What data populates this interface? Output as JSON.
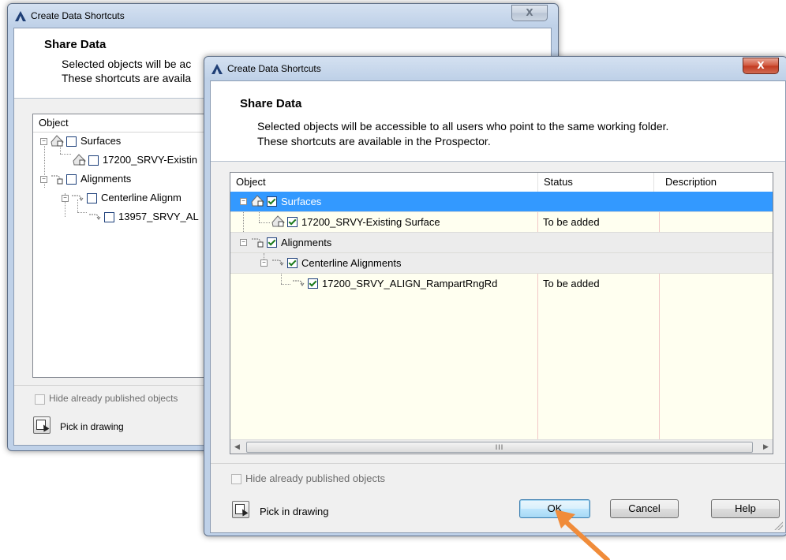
{
  "background_dialog": {
    "title": "Create Data Shortcuts",
    "close_label": "X",
    "heading": "Share Data",
    "desc_line1": "Selected objects will be ac",
    "desc_line2": "These shortcuts are availa",
    "column_object": "Object",
    "tree": [
      {
        "label": "Surfaces",
        "checked": false
      },
      {
        "label": "17200_SRVY-Existin",
        "checked": false
      },
      {
        "label": "Alignments",
        "checked": false
      },
      {
        "label": "Centerline Alignm",
        "checked": false
      },
      {
        "label": "13957_SRVY_AL",
        "checked": false
      }
    ],
    "hide_published_label": "Hide already published objects",
    "pick_label": "Pick in drawing"
  },
  "dialog": {
    "title": "Create Data Shortcuts",
    "close_label": "X",
    "heading": "Share Data",
    "desc_line1": "Selected objects will be accessible to all users who point to the same working folder.",
    "desc_line2": "These shortcuts are available in the Prospector.",
    "columns": {
      "object": "Object",
      "status": "Status",
      "description": "Description"
    },
    "rows": [
      {
        "label": "Surfaces",
        "status": "",
        "description": "",
        "checked": true,
        "selected": true
      },
      {
        "label": "17200_SRVY-Existing Surface",
        "status": "To be added",
        "description": "",
        "checked": true
      },
      {
        "label": "Alignments",
        "status": "",
        "description": "",
        "checked": true
      },
      {
        "label": "Centerline Alignments",
        "status": "",
        "description": "",
        "checked": true
      },
      {
        "label": "17200_SRVY_ALIGN_RampartRngRd",
        "status": "To be added",
        "description": "",
        "checked": true
      }
    ],
    "scroll_grip": "III",
    "hide_published_label": "Hide already published objects",
    "hide_published_checked": false,
    "pick_label": "Pick in drawing",
    "buttons": {
      "ok": "OK",
      "cancel": "Cancel",
      "help": "Help"
    }
  },
  "colors": {
    "selection": "#3399ff",
    "arrow": "#f08c3a",
    "grid_bg": "#fffff0"
  }
}
